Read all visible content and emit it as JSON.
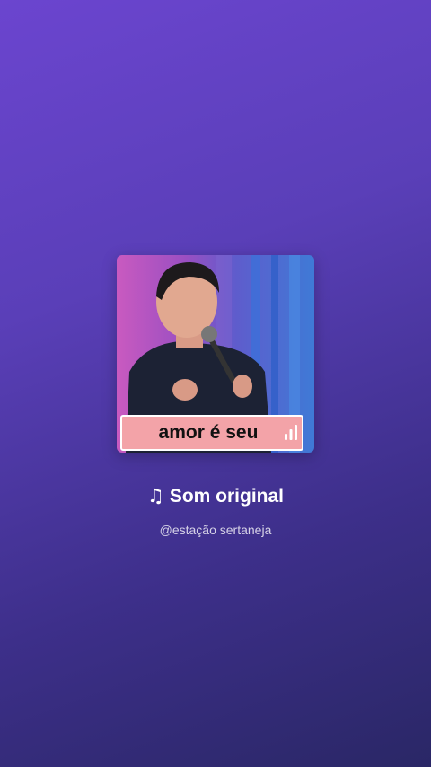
{
  "sound": {
    "title": "Som original",
    "title_icon": "music-note-icon",
    "author": "@estação sertaneja"
  },
  "cover": {
    "caption": "amor é seu",
    "caption_icon": "signal-bars-icon",
    "caption_bg": "#f3a3a8"
  },
  "colors": {
    "background_top": "#6b45cf",
    "background_bottom": "#2a2766",
    "text": "#ffffff"
  }
}
